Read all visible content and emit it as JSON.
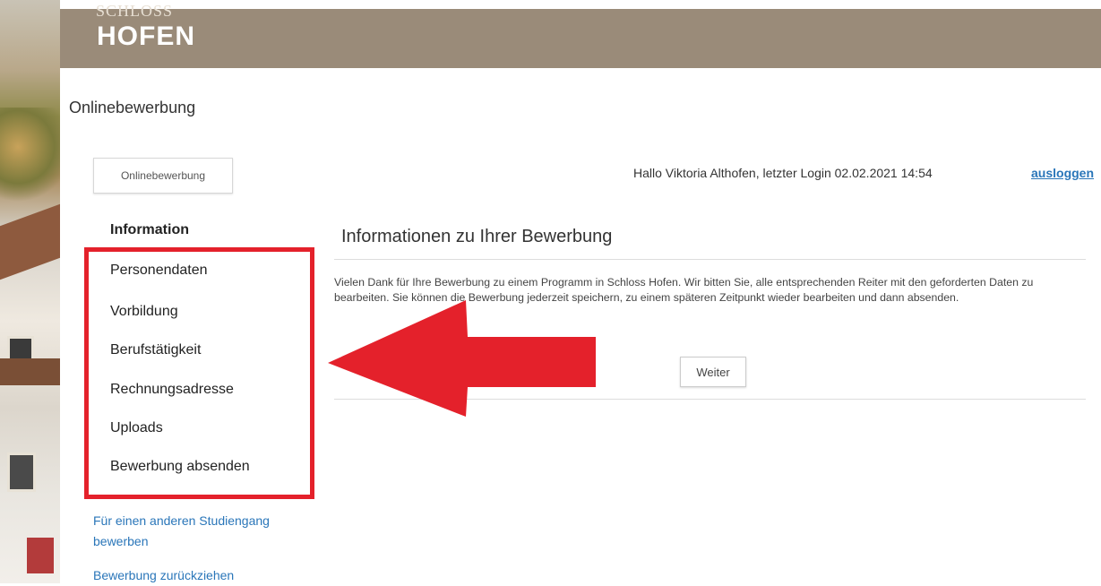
{
  "brand": {
    "logo_top": "SCHLOSS",
    "logo": "HOFEN"
  },
  "page_heading": "Onlinebewerbung",
  "tab_button": "Onlinebewerbung",
  "user": {
    "greeting": "Hallo Viktoria Althofen, letzter Login 02.02.2021 14:54",
    "logout_label": "ausloggen"
  },
  "nav": {
    "active": "Information",
    "items": [
      "Personendaten",
      "Vorbildung",
      "Berufstätigkeit",
      "Rechnungsadresse",
      "Uploads",
      "Bewerbung absenden"
    ],
    "links": [
      "Für einen anderen Studiengang bewerben",
      "Bewerbung zurückziehen"
    ]
  },
  "content": {
    "title": "Informationen zu Ihrer Bewerbung",
    "text": "Vielen Dank für Ihre Bewerbung zu einem Programm in Schloss Hofen. Wir bitten Sie, alle entsprechenden Reiter mit den geforderten Daten zu bearbeiten. Sie können die Bewerbung jederzeit speichern, zu einem späteren Zeitpunkt wieder bearbeiten und dann absenden.",
    "next_button": "Weiter"
  },
  "annotation": {
    "color": "#e4212b"
  }
}
